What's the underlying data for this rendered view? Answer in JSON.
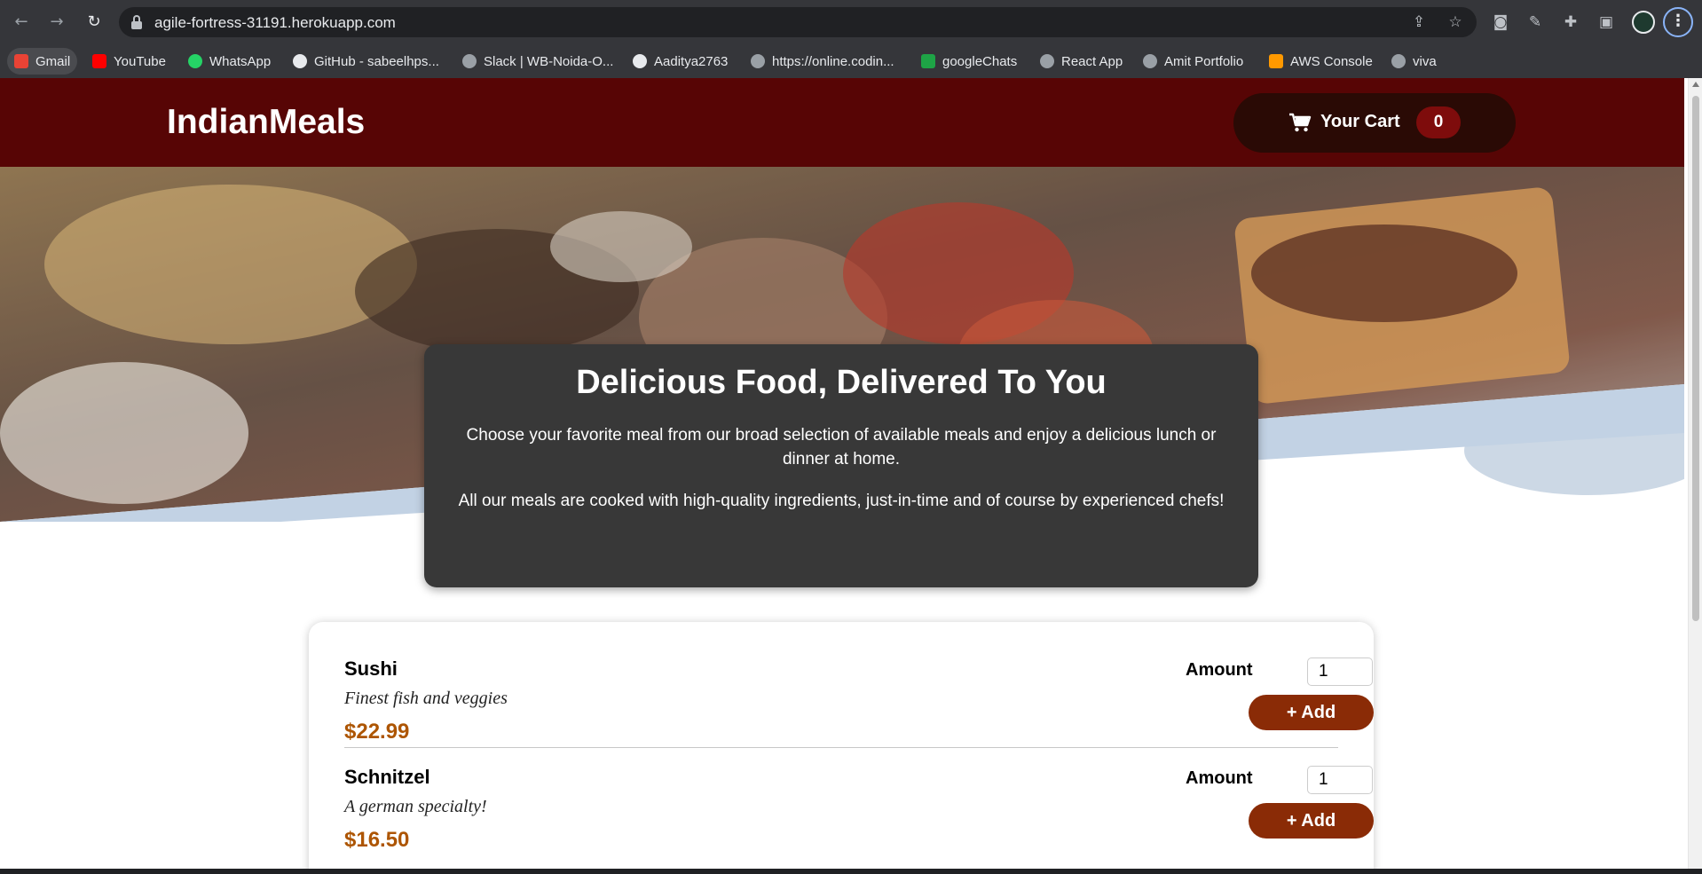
{
  "browser": {
    "url": "agile-fortress-31191.herokuapp.com",
    "bookmarks": [
      {
        "label": "Gmail",
        "icon": "gmail-icon",
        "color": "#ea4335"
      },
      {
        "label": "YouTube",
        "icon": "youtube-icon",
        "color": "#ff0000"
      },
      {
        "label": "WhatsApp",
        "icon": "whatsapp-icon",
        "color": "#25d366"
      },
      {
        "label": "GitHub - sabeelhps...",
        "icon": "github-icon",
        "color": "#e8eaed"
      },
      {
        "label": "Slack | WB-Noida-O...",
        "icon": "globe-icon",
        "color": "#9aa0a6"
      },
      {
        "label": "Aaditya2763",
        "icon": "github-icon",
        "color": "#e8eaed"
      },
      {
        "label": "https://online.codin...",
        "icon": "globe-icon",
        "color": "#9aa0a6"
      },
      {
        "label": "googleChats",
        "icon": "google-chat-icon",
        "color": "#1ea446"
      },
      {
        "label": "React App",
        "icon": "globe-icon",
        "color": "#9aa0a6"
      },
      {
        "label": "Amit Portfolio",
        "icon": "globe-icon",
        "color": "#9aa0a6"
      },
      {
        "label": "AWS Console",
        "icon": "aws-icon",
        "color": "#ff9900"
      },
      {
        "label": "viva",
        "icon": "globe-icon",
        "color": "#9aa0a6"
      }
    ]
  },
  "header": {
    "logo": "IndianMeals",
    "cart_label": "Your Cart",
    "cart_count": "0",
    "brand_color": "#570505"
  },
  "summary": {
    "title": "Delicious Food, Delivered To You",
    "paragraph1": "Choose your favorite meal from our broad selection of available meals and enjoy a delicious lunch or dinner at home.",
    "paragraph2": "All our meals are cooked with high-quality ingredients, just-in-time and of course by experienced chefs!"
  },
  "meals": [
    {
      "name": "Sushi",
      "description": "Finest fish and veggies",
      "price": "$22.99",
      "amount_label": "Amount",
      "amount_value": "1",
      "add_label": "+ Add"
    },
    {
      "name": "Schnitzel",
      "description": "A german specialty!",
      "price": "$16.50",
      "amount_label": "Amount",
      "amount_value": "1",
      "add_label": "+ Add"
    }
  ]
}
